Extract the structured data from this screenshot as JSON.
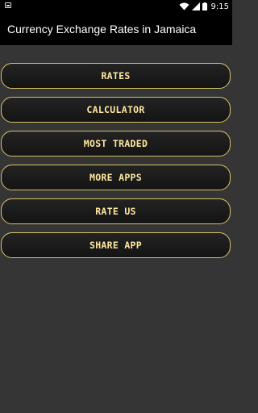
{
  "status_bar": {
    "time": "9:15",
    "icons": [
      "notification-icon",
      "wifi-icon",
      "signal-icon",
      "battery-icon"
    ]
  },
  "app_bar": {
    "title": "Currency Exchange Rates in Jamaica"
  },
  "menu": {
    "buttons": [
      {
        "label": "RATES"
      },
      {
        "label": "CALCULATOR"
      },
      {
        "label": "MOST TRADED"
      },
      {
        "label": "MORE APPS"
      },
      {
        "label": "RATE US"
      },
      {
        "label": "SHARE APP"
      }
    ]
  },
  "colors": {
    "background": "#353535",
    "bar": "#000000",
    "button_border": "#d7c46a",
    "button_text": "#ffe8a0"
  }
}
